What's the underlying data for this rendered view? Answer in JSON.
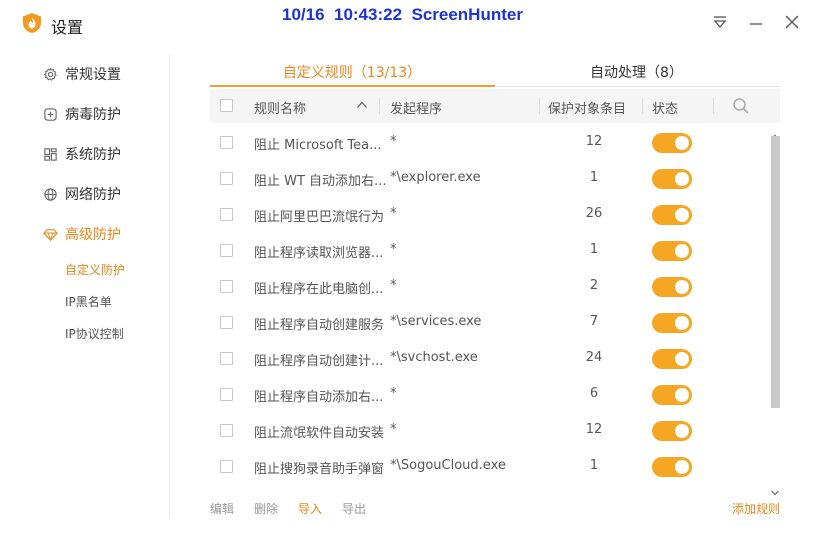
{
  "window": {
    "title": "设置",
    "watermark": "10/16  10:43:22  ScreenHunter"
  },
  "colors": {
    "accent": "#e8871d",
    "toggle_on": "#f5a623"
  },
  "sidebar": {
    "items": [
      {
        "label": "常规设置",
        "icon": "gear-icon"
      },
      {
        "label": "病毒防护",
        "icon": "plus-square-icon"
      },
      {
        "label": "系统防护",
        "icon": "grid-icon"
      },
      {
        "label": "网络防护",
        "icon": "globe-icon"
      },
      {
        "label": "高级防护",
        "icon": "diamond-icon",
        "active": true
      }
    ],
    "sub_items": [
      {
        "label": "自定义防护",
        "active": true
      },
      {
        "label": "IP黑名单"
      },
      {
        "label": "IP协议控制"
      }
    ]
  },
  "tabs": [
    {
      "label": "自定义规则（13/13）",
      "active": true
    },
    {
      "label": "自动处理（8）"
    }
  ],
  "table": {
    "columns": [
      "规则名称",
      "发起程序",
      "保护对象条目",
      "状态"
    ],
    "rows": [
      {
        "name": "阻止 Microsoft Tea...",
        "program": "*",
        "count": "12",
        "enabled": true
      },
      {
        "name": "阻止 WT 自动添加右...",
        "program": "*\\explorer.exe",
        "count": "1",
        "enabled": true
      },
      {
        "name": "阻止阿里巴巴流氓行为",
        "program": "*",
        "count": "26",
        "enabled": true
      },
      {
        "name": "阻止程序读取浏览器...",
        "program": "*",
        "count": "1",
        "enabled": true
      },
      {
        "name": "阻止程序在此电脑创...",
        "program": "*",
        "count": "2",
        "enabled": true
      },
      {
        "name": "阻止程序自动创建服务",
        "program": "*\\services.exe",
        "count": "7",
        "enabled": true
      },
      {
        "name": "阻止程序自动创建计...",
        "program": "*\\svchost.exe",
        "count": "24",
        "enabled": true
      },
      {
        "name": "阻止程序自动添加右...",
        "program": "*",
        "count": "6",
        "enabled": true
      },
      {
        "name": "阻止流氓软件自动安装",
        "program": "*",
        "count": "12",
        "enabled": true
      },
      {
        "name": "阻止搜狗录音助手弹窗",
        "program": "*\\SogouCloud.exe",
        "count": "1",
        "enabled": true
      }
    ]
  },
  "footer": {
    "edit": "编辑",
    "delete": "删除",
    "import": "导入",
    "export": "导出",
    "add_rule": "添加规则"
  }
}
